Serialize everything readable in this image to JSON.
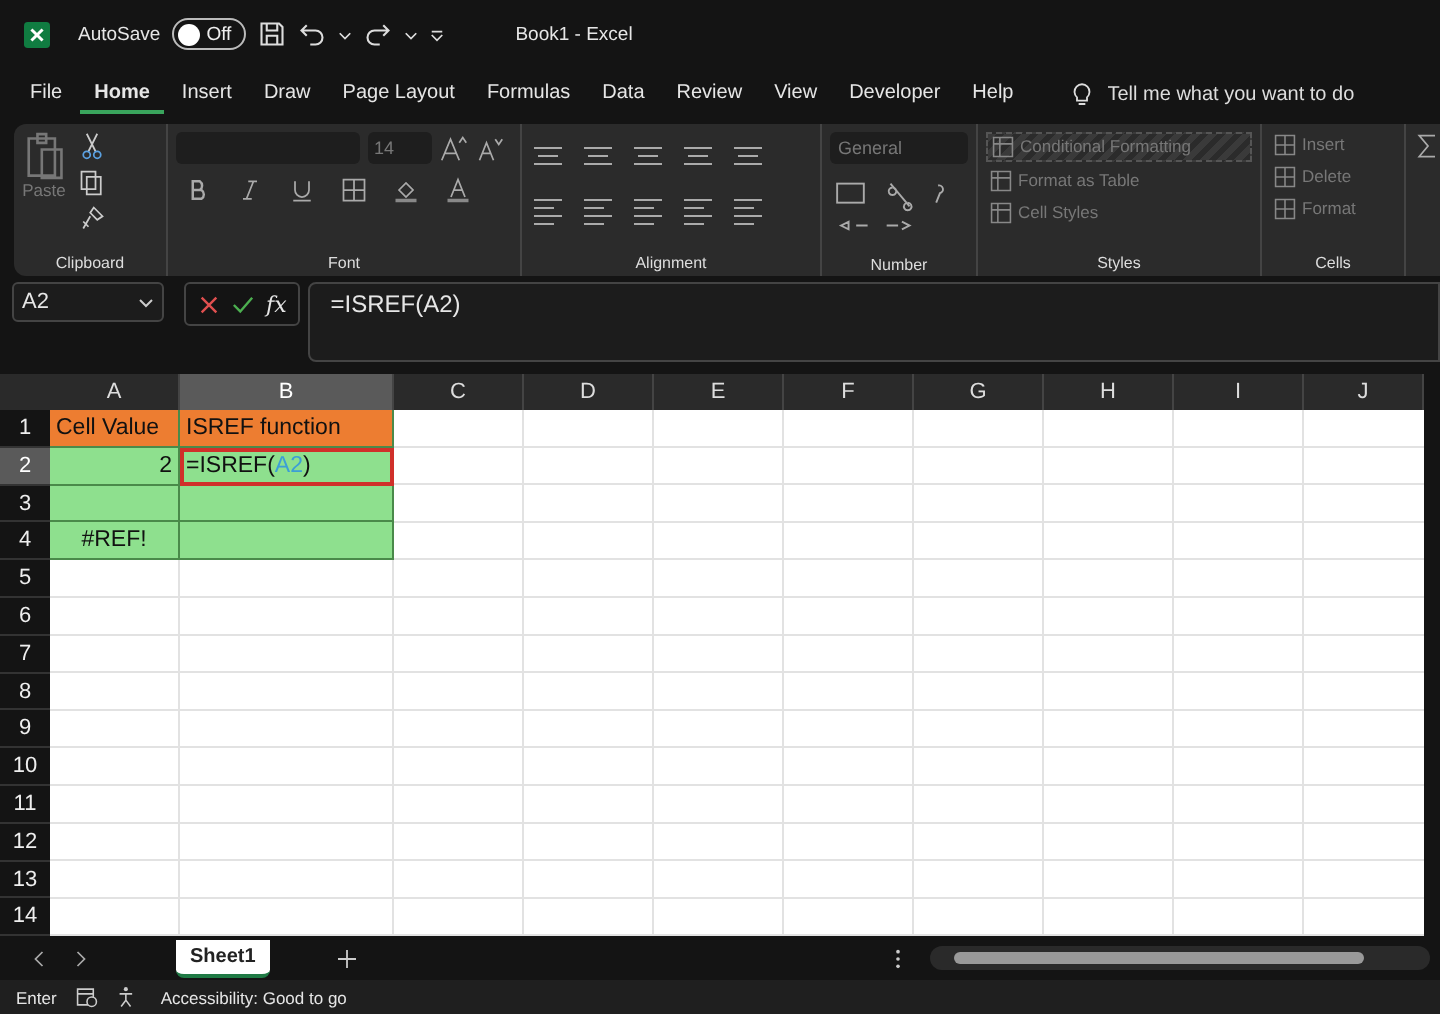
{
  "title_bar": {
    "autosave_label": "AutoSave",
    "autosave": {
      "label": "Off",
      "on": false
    },
    "title": "Book1  -  Excel"
  },
  "menu": [
    {
      "label": "File",
      "selected": false
    },
    {
      "label": "Home",
      "selected": true
    },
    {
      "label": "Insert",
      "selected": false
    },
    {
      "label": "Draw",
      "selected": false
    },
    {
      "label": "Page Layout",
      "selected": false
    },
    {
      "label": "Formulas",
      "selected": false
    },
    {
      "label": "Data",
      "selected": false
    },
    {
      "label": "Review",
      "selected": false
    },
    {
      "label": "View",
      "selected": false
    },
    {
      "label": "Developer",
      "selected": false
    },
    {
      "label": "Help",
      "selected": false
    }
  ],
  "tell_me": {
    "placeholder": "Tell me what you want to do"
  },
  "ribbon": {
    "paste": {
      "label": "Paste",
      "disabled": true
    },
    "font_size": "14",
    "number_format": "General",
    "styles": [
      {
        "label": "Conditional Formatting",
        "disabled": true
      },
      {
        "label": "Format as Table",
        "disabled": true
      },
      {
        "label": "Cell Styles",
        "disabled": true
      }
    ],
    "cells": [
      {
        "label": "Insert",
        "disabled": true
      },
      {
        "label": "Delete",
        "disabled": true
      },
      {
        "label": "Format",
        "disabled": true
      }
    ],
    "groups": [
      "Clipboard",
      "Font",
      "Alignment",
      "Number",
      "Styles",
      "Cells"
    ]
  },
  "formula_bar": {
    "name_box": "A2",
    "function_label": "fx",
    "formula": "=ISREF(A2)"
  },
  "columns": [
    {
      "label": "A",
      "selected": false
    },
    {
      "label": "B",
      "selected": true
    },
    {
      "label": "C",
      "selected": false
    },
    {
      "label": "D",
      "selected": false
    },
    {
      "label": "E",
      "selected": false
    },
    {
      "label": "F",
      "selected": false
    },
    {
      "label": "G",
      "selected": false
    },
    {
      "label": "H",
      "selected": false
    },
    {
      "label": "I",
      "selected": false
    },
    {
      "label": "J",
      "selected": false
    }
  ],
  "rows": [
    {
      "label": "1",
      "selected": false,
      "cells": [
        {
          "kind": "text",
          "parts": [
            {
              "text": "Cell Value"
            }
          ],
          "color": "#ed7d31",
          "outlined": false
        },
        {
          "kind": "text",
          "parts": [
            {
              "text": "ISREF function"
            }
          ],
          "color": "#ed7d31",
          "outlined": false
        }
      ]
    },
    {
      "label": "2",
      "selected": true,
      "cells": [
        {
          "kind": "number",
          "parts": [
            {
              "text": "2"
            }
          ],
          "color": "#8ee08e",
          "outlined": false
        },
        {
          "kind": "text",
          "parts": [
            {
              "text": "=ISREF("
            },
            {
              "text": "A2",
              "color": "#3c9fd6"
            },
            {
              "text": ")"
            }
          ],
          "color": "#8ee08e",
          "outlined": true
        }
      ]
    },
    {
      "label": "3",
      "selected": false,
      "cells": [
        {
          "kind": "empty",
          "color": "#8ee08e",
          "outlined": false
        },
        {
          "kind": "empty",
          "color": "#8ee08e",
          "outlined": false
        }
      ]
    },
    {
      "label": "4",
      "selected": false,
      "cells": [
        {
          "kind": "error",
          "parts": [
            {
              "text": "#REF!"
            }
          ],
          "color": "#8ee08e",
          "outlined": false
        },
        {
          "kind": "empty",
          "color": "#8ee08e",
          "outlined": false
        }
      ]
    },
    {
      "label": "5",
      "selected": false,
      "cells": []
    },
    {
      "label": "6",
      "selected": false,
      "cells": []
    },
    {
      "label": "7",
      "selected": false,
      "cells": []
    },
    {
      "label": "8",
      "selected": false,
      "cells": []
    },
    {
      "label": "9",
      "selected": false,
      "cells": []
    },
    {
      "label": "10",
      "selected": false,
      "cells": []
    },
    {
      "label": "11",
      "selected": false,
      "cells": []
    },
    {
      "label": "12",
      "selected": false,
      "cells": []
    },
    {
      "label": "13",
      "selected": false,
      "cells": []
    },
    {
      "label": "14",
      "selected": false,
      "cells": []
    }
  ],
  "sheets": [
    {
      "label": "Sheet1",
      "selected": true
    }
  ],
  "status_bar": {
    "mode": "Enter",
    "accessibility": "Accessibility: Good to go"
  }
}
